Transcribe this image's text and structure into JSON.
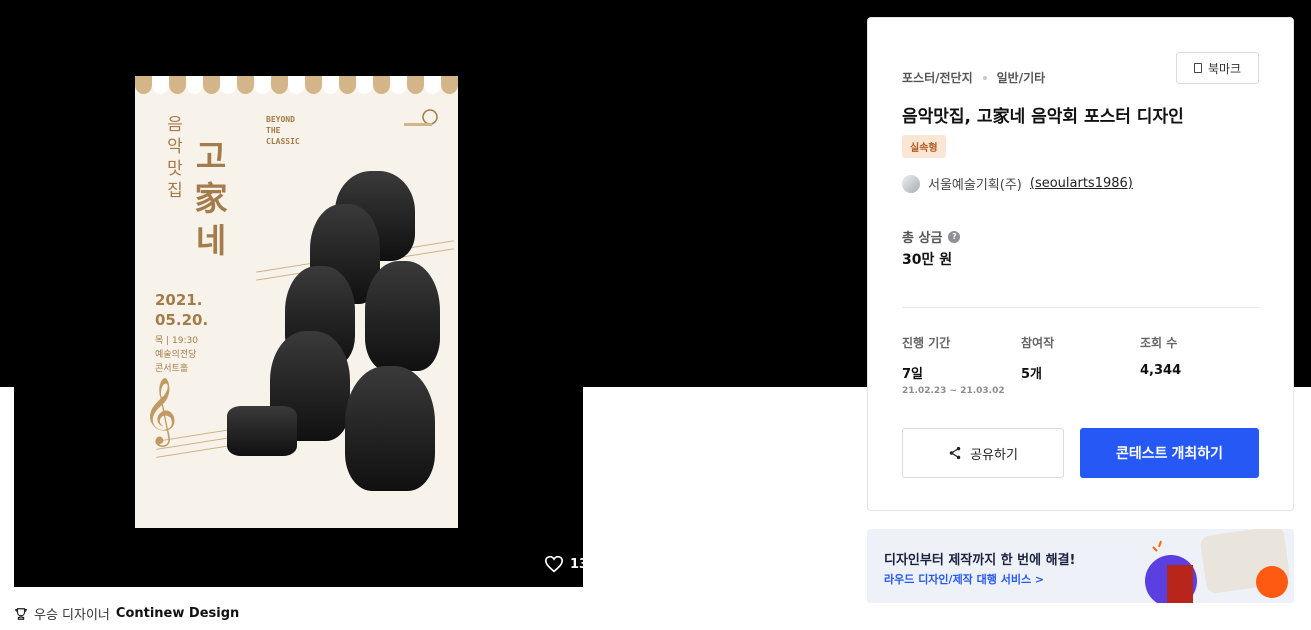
{
  "poster": {
    "title_small": "음악맛집",
    "title_large": "고家네",
    "subtitle": "BEYOND\nTHE\nCLASSIC",
    "date": "2021.\n05.20.",
    "venue": "목 | 19:30\n예술의전당\n콘서트홀",
    "likes": "13"
  },
  "award": {
    "label": "우승 디자이너",
    "designer": "Continew Design"
  },
  "info": {
    "category": "포스터/전단지",
    "subcategory": "일반/기타",
    "bookmark_label": "북마크",
    "title": "음악맛집, 고家네 음악회 포스터 디자인",
    "badge": "실속형",
    "host_name": "서울예술기획(주)",
    "host_id": "(seoularts1986)",
    "prize_label": "총 상금",
    "prize_value": "30만 원",
    "stats": [
      {
        "label": "진행 기간",
        "value": "7일",
        "sub": "21.02.23 ~ 21.03.02"
      },
      {
        "label": "참여작",
        "value": "5개",
        "sub": ""
      },
      {
        "label": "조회 수",
        "value": "4,344",
        "sub": ""
      }
    ],
    "share_label": "공유하기",
    "host_contest_label": "콘테스트 개최하기"
  },
  "promo": {
    "title": "디자인부터 제작까지 한 번에 해결!",
    "link": "라우드 디자인/제작 대행 서비스 >"
  },
  "icons": {
    "heart": "heart-icon",
    "trophy": "trophy-icon",
    "share": "share-icon",
    "bookmark": "bookmark-icon",
    "help": "help-icon"
  },
  "colors": {
    "primary": "#2558f5",
    "badge_bg": "#fbe6d6",
    "badge_text": "#b45d22",
    "poster_gold": "#a47b4a",
    "fab": "#ff5a12"
  }
}
